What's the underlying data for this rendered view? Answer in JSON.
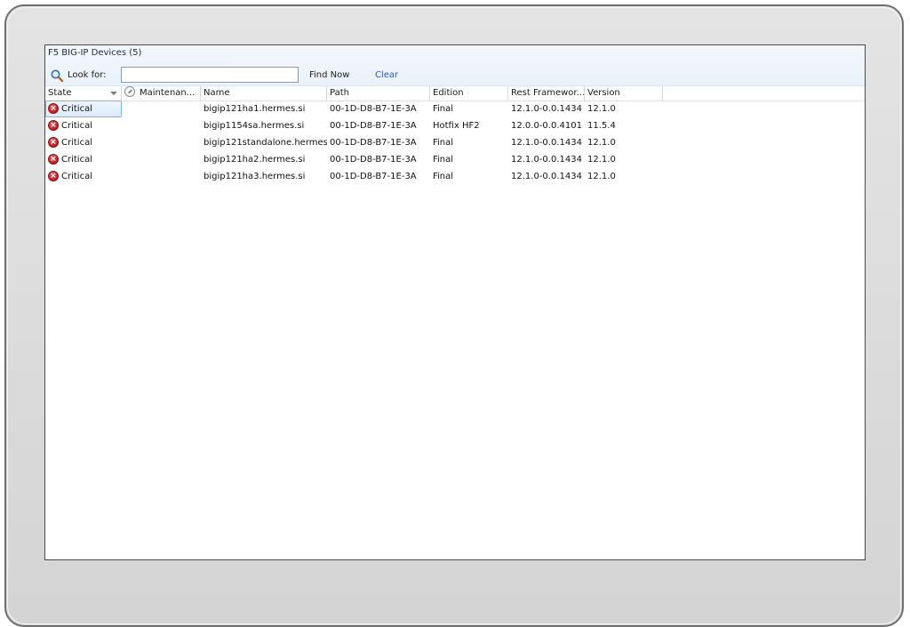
{
  "panel": {
    "title": "F5 BIG-IP Devices (5)"
  },
  "search": {
    "label": "Look for:",
    "value": "",
    "placeholder": "",
    "find_now_label": "Find Now",
    "clear_label": "Clear"
  },
  "columns": {
    "state": "State",
    "maintenance": "Maintenan...",
    "name": "Name",
    "path": "Path",
    "edition": "Edition",
    "rest_framework": "Rest Framewor...",
    "version": "Version"
  },
  "rows": [
    {
      "state": "Critical",
      "state_icon": "critical-error-icon",
      "name": "bigip121ha1.hermes.si",
      "path": "00-1D-D8-B7-1E-3A",
      "edition": "Final",
      "rest_framework": "12.1.0-0.0.1434",
      "version": "12.1.0"
    },
    {
      "state": "Critical",
      "state_icon": "critical-error-icon",
      "name": "bigip1154sa.hermes.si",
      "path": "00-1D-D8-B7-1E-3A",
      "edition": "Hotfix HF2",
      "rest_framework": "12.0.0-0.0.4101",
      "version": "11.5.4"
    },
    {
      "state": "Critical",
      "state_icon": "critical-error-icon",
      "name": "bigip121standalone.hermes...",
      "path": "00-1D-D8-B7-1E-3A",
      "edition": "Final",
      "rest_framework": "12.1.0-0.0.1434",
      "version": "12.1.0"
    },
    {
      "state": "Critical",
      "state_icon": "critical-error-icon",
      "name": "bigip121ha2.hermes.si",
      "path": "00-1D-D8-B7-1E-3A",
      "edition": "Final",
      "rest_framework": "12.1.0-0.0.1434",
      "version": "12.1.0"
    },
    {
      "state": "Critical",
      "state_icon": "critical-error-icon",
      "name": "bigip121ha3.hermes.si",
      "path": "00-1D-D8-B7-1E-3A",
      "edition": "Final",
      "rest_framework": "12.1.0-0.0.1434",
      "version": "12.1.0"
    }
  ],
  "selected_row": 0,
  "colors": {
    "critical": "#c62828",
    "link": "#2a58c4",
    "selection": "#dcecfc",
    "header_bg": "#eaf1fa"
  }
}
